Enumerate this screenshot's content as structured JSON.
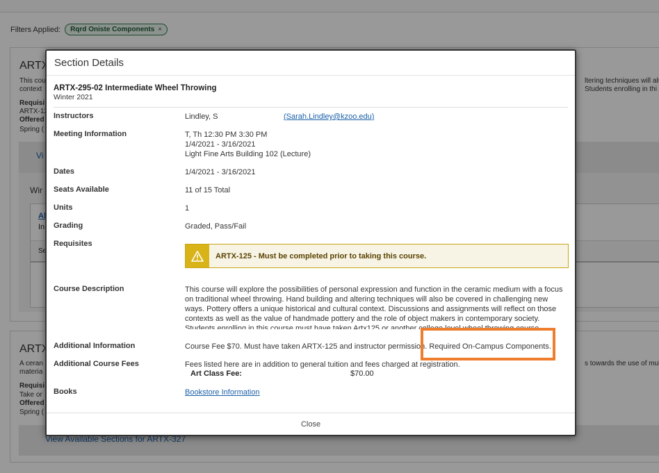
{
  "filters": {
    "label": "Filters Applied:",
    "chips": [
      {
        "label": "Rqrd Oniste Components",
        "remove": "×"
      }
    ]
  },
  "background": {
    "card1": {
      "title_partial": "ARTX",
      "desc_left_1": "This cou",
      "desc_left_2": "context",
      "req_label": "Requisi",
      "req_val": "ARTX-12",
      "offered": "Offered",
      "spring": "Spring (",
      "right_1": "ltering techniques will als",
      "right_2": "Students enrolling in thi",
      "view_link": "Vi",
      "winter": "Wir",
      "inner_link": "Al",
      "inner_text": "In",
      "se": "Se"
    },
    "card2": {
      "title_partial": "ARTX",
      "desc_1": "A ceran",
      "desc_2": "materia",
      "req_label": "Requisi",
      "take": "Take or",
      "offered": "Offered",
      "spring": "Spring (",
      "right_1": "s towards the use of multi",
      "view_link": "View Available Sections for ARTX-327"
    }
  },
  "modal": {
    "title": "Section Details",
    "course_name": "ARTX-295-02 Intermediate Wheel Throwing",
    "term": "Winter 2021",
    "instructors": {
      "label": "Instructors",
      "name": "Lindley, S",
      "email": "(Sarah.Lindley@kzoo.edu)"
    },
    "meeting": {
      "label": "Meeting Information",
      "line1": "T, Th 12:30 PM 3:30 PM",
      "line2": "1/4/2021 - 3/16/2021",
      "line3": "Light Fine Arts Building 102 (Lecture)"
    },
    "dates": {
      "label": "Dates",
      "value": "1/4/2021 - 3/16/2021"
    },
    "seats": {
      "label": "Seats Available",
      "value": "11 of 15 Total"
    },
    "units": {
      "label": "Units",
      "value": "1"
    },
    "grading": {
      "label": "Grading",
      "value": "Graded, Pass/Fail"
    },
    "requisites": {
      "label": "Requisites",
      "warning": "ARTX-125 - Must be completed prior to taking this course."
    },
    "course_description": {
      "label": "Course Description",
      "text": "This course will explore the possibilities of personal expression and function in the ceramic medium with a focus on traditional wheel throwing. Hand building and altering techniques will also be covered in challenging new ways. Pottery offers a unique historical and cultural context. Discussions and assignments will reflect on those contexts as well as the value of handmade pottery and the role of object makers in contemporary society. Students enrolling in this course must have taken Artx125 or another college level wheel throwing course."
    },
    "additional_info": {
      "label": "Additional Information",
      "value": "Course Fee $70. Must have taken ARTX-125 and instructor permission. Required On-Campus Components."
    },
    "fees": {
      "label": "Additional Course Fees",
      "intro": "Fees listed here are in addition to general tuition and fees charged at registration.",
      "fee_name": "Art Class Fee:",
      "fee_amount": "$70.00"
    },
    "books": {
      "label": "Books",
      "link": "Bookstore Information"
    },
    "close": "Close"
  },
  "colors": {
    "highlight": "#ee7d2e",
    "warning_bg": "#f7f3e5",
    "warning_icon": "#d8b418",
    "chip_border": "#2f7a4d"
  }
}
